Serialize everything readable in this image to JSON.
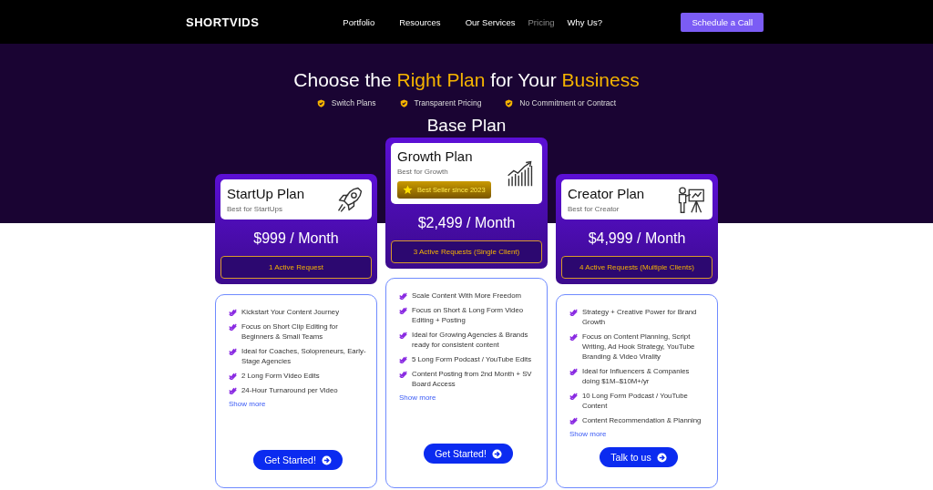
{
  "header": {
    "logo": "SHORTVIDS",
    "nav": [
      {
        "label": "Portfolio",
        "selected": false
      },
      {
        "label": "Resources",
        "selected": false
      },
      {
        "label": "Our Services",
        "selected": false
      },
      {
        "label": "Pricing",
        "selected": true
      },
      {
        "label": "Why Us?",
        "selected": false
      }
    ],
    "cta": "Schedule a Call"
  },
  "hero": {
    "headline": [
      {
        "text": "Choose the ",
        "highlight": false
      },
      {
        "text": "Right Plan",
        "highlight": true
      },
      {
        "text": " for Your ",
        "highlight": false
      },
      {
        "text": "Business",
        "highlight": true
      }
    ],
    "perks": [
      "Switch Plans",
      "Transparent Pricing",
      "No Commitment or Contract"
    ],
    "section_title": "Base Plan"
  },
  "plans": [
    {
      "name": "StartUp Plan",
      "subtitle": "Best for StartUps",
      "featured": false,
      "price": "$999 / Month",
      "requests": "1 Active Request",
      "features": [
        "Kickstart Your Content Journey",
        "Focus on Short Clip Editing for Beginners & Small Teams",
        "Ideal for Coaches, Solopreneurs, Early-Stage Agencies",
        "2 Long Form Video Edits",
        "24-Hour Turnaround per Video"
      ],
      "show_more": "Show more",
      "button": "Get Started!"
    },
    {
      "name": "Growth Plan",
      "subtitle": "Best for Growth",
      "featured": true,
      "badge": "Best Seller since 2023",
      "price": "$2,499 / Month",
      "requests": "3 Active Requests (Single Client)",
      "features": [
        "Scale Content With More Freedom",
        "Focus on Short & Long Form Video Editing + Posting",
        "Ideal for Growing Agencies & Brands ready for consistent content",
        "5 Long Form Podcast / YouTube Edits",
        "Content Posting from 2nd Month + SV Board Access"
      ],
      "show_more": "Show more",
      "button": "Get Started!"
    },
    {
      "name": "Creator Plan",
      "subtitle": "Best for Creator",
      "featured": false,
      "price": "$4,999 / Month",
      "requests": "4 Active Requests (Multiple Clients)",
      "features": [
        "Strategy + Creative Power for Brand Growth",
        "Focus on Content Planning, Script Writing, Ad Hook Strategy, YouTube Branding & Video Virality",
        "Ideal for Influencers & Companies doing $1M–$10M+/yr",
        "10 Long Form Podcast / YouTube Content",
        "Content Recommendation & Planning"
      ],
      "show_more": "Show more",
      "button": "Talk to us"
    }
  ]
}
